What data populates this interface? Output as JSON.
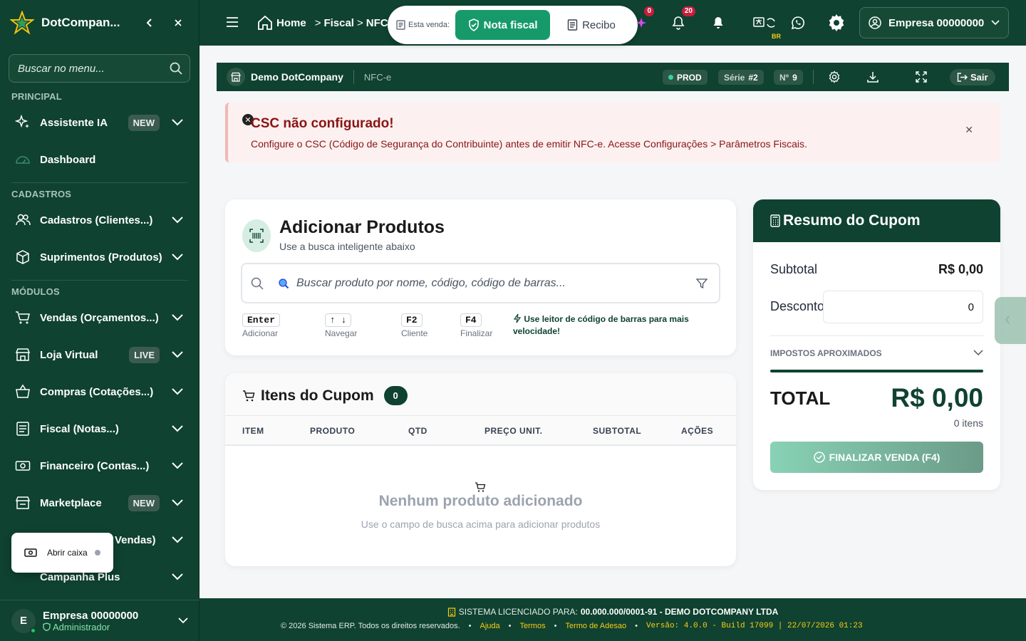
{
  "sidebar": {
    "brand": "DotCompan...",
    "search_placeholder": "Buscar no menu...",
    "sections": {
      "principal": "PRINCIPAL",
      "cadastros": "CADASTROS",
      "modulos": "MÓDULOS"
    },
    "items": {
      "assistente": {
        "label": "Assistente IA",
        "badge": "NEW"
      },
      "dashboard": {
        "label": "Dashboard"
      },
      "cadastros": {
        "label": "Cadastros (Clientes...)"
      },
      "suprimentos": {
        "label": "Suprimentos (Produtos)"
      },
      "vendas": {
        "label": "Vendas (Orçamentos...)"
      },
      "loja": {
        "label": "Loja Virtual",
        "badge": "LIVE"
      },
      "compras": {
        "label": "Compras (Cotações...)"
      },
      "fiscal": {
        "label": "Fiscal (Notas...)"
      },
      "financeiro": {
        "label": "Financeiro (Contas...)"
      },
      "marketplace": {
        "label": "Marketplace",
        "badge": "NEW"
      },
      "pdv": {
        "label": "Vendas)"
      },
      "campanha": {
        "label": "Campanha Plus"
      }
    },
    "popup": {
      "label": "Abrir caixa"
    },
    "footer": {
      "initial": "E",
      "name": "Empresa 00000000",
      "role": "Administrador"
    }
  },
  "topbar": {
    "breadcrumb": [
      "Home",
      "Fiscal",
      "NFC-e"
    ],
    "sale_label": "Esta venda:",
    "nota_fiscal": "Nota fiscal",
    "recibo": "Recibo",
    "cart_count": "0",
    "notif_count": "20",
    "br_tag": "BR",
    "company": "Empresa 00000000"
  },
  "bar": {
    "title": "Demo DotCompany",
    "subtitle": "NFC-e",
    "env": "PROD",
    "serie_label": "Série",
    "serie": "#2",
    "num_label": "Nº",
    "num": "9",
    "sair": "Sair"
  },
  "alert": {
    "title": "CSC não configurado!",
    "message": "Configure o CSC (Código de Segurança do Contribuinte) antes de emitir NFC-e. Acesse Configurações > Parâmetros Fiscais."
  },
  "add_products": {
    "title": "Adicionar Produtos",
    "subtitle": "Use a busca inteligente abaixo",
    "search_placeholder": "Buscar produto por nome, código, código de barras...",
    "shortcuts": [
      {
        "keys": "Enter",
        "label": "Adicionar"
      },
      {
        "keys": "↑ ↓",
        "label": "Navegar"
      },
      {
        "keys": "F2",
        "label": "Cliente"
      },
      {
        "keys": "F4",
        "label": "Finalizar"
      }
    ],
    "tip": "Use leitor de código de barras para mais velocidade!"
  },
  "items": {
    "title": "Itens do Cupom",
    "count": "0",
    "columns": [
      "ITEM",
      "PRODUTO",
      "QTD",
      "PREÇO UNIT.",
      "SUBTOTAL",
      "AÇÕES"
    ],
    "empty_title": "Nenhum produto adicionado",
    "empty_subtitle": "Use o campo de busca acima para adicionar produtos"
  },
  "summary": {
    "title": "Resumo do Cupom",
    "subtotal_label": "Subtotal",
    "subtotal": "R$ 0,00",
    "discount_label": "Desconto",
    "discount": "0",
    "taxes_label": "IMPOSTOS APROXIMADOS",
    "total_label": "TOTAL",
    "total": "R$ 0,00",
    "items_count": "0 itens",
    "finish": "FINALIZAR VENDA (F4)"
  },
  "footer": {
    "license_label": "SISTEMA LICENCIADO PARA:",
    "license_value": "00.000.000/0001-91 - DEMO DOTCOMPANY LTDA",
    "copyright": "© 2026 Sistema ERP. Todos os direitos reservados.",
    "links": [
      "Ajuda",
      "Termos",
      "Termo de Adesao"
    ],
    "version": "Versão: 4.0.0 - Build 17099 | 22/07/2026 01:23"
  },
  "colors": {
    "primary": "#0f4230",
    "accent": "#179a6a",
    "alert_bg": "#fdf0f0",
    "alert_text": "#8a1414"
  }
}
